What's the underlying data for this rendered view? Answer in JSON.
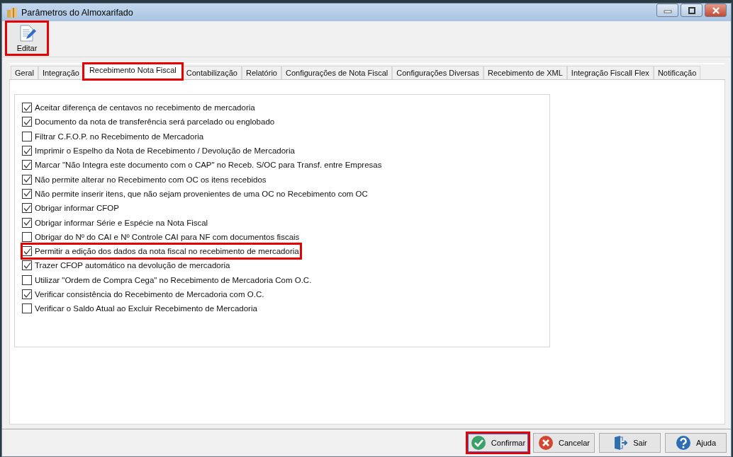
{
  "window": {
    "title": "Parâmetros do Almoxarifado"
  },
  "toolbar": [
    {
      "label": "Editar",
      "highlighted": true
    }
  ],
  "tabs": [
    {
      "label": "Geral",
      "selected": false,
      "highlighted": false
    },
    {
      "label": "Integração",
      "selected": false,
      "highlighted": false
    },
    {
      "label": "Recebimento Nota Fiscal",
      "selected": true,
      "highlighted": true
    },
    {
      "label": "Contabilização",
      "selected": false,
      "highlighted": false
    },
    {
      "label": "Relatório",
      "selected": false,
      "highlighted": false
    },
    {
      "label": "Configurações de Nota Fiscal",
      "selected": false,
      "highlighted": false
    },
    {
      "label": "Configurações Diversas",
      "selected": false,
      "highlighted": false
    },
    {
      "label": "Recebimento de XML",
      "selected": false,
      "highlighted": false
    },
    {
      "label": "Integração Fiscall Flex",
      "selected": false,
      "highlighted": false
    },
    {
      "label": "Notificação",
      "selected": false,
      "highlighted": false
    }
  ],
  "options": [
    {
      "label": "Aceitar diferença de centavos no recebimento de mercadoria",
      "checked": true,
      "highlighted": false
    },
    {
      "label": "Documento da nota de transferência será parcelado ou englobado",
      "checked": true,
      "highlighted": false
    },
    {
      "label": "Filtrar C.F.O.P. no Recebimento de Mercadoria",
      "checked": false,
      "highlighted": false
    },
    {
      "label": "Imprimir o Espelho da Nota de Recebimento / Devolução de Mercadoria",
      "checked": true,
      "highlighted": false
    },
    {
      "label": "Marcar \"Não Integra este documento com o CAP\" no Receb. S/OC para Transf. entre Empresas",
      "checked": true,
      "highlighted": false
    },
    {
      "label": "Não permite alterar no Recebimento com OC os itens recebidos",
      "checked": true,
      "highlighted": false
    },
    {
      "label": "Não permite inserir itens, que não sejam provenientes de uma OC no Recebimento com OC",
      "checked": true,
      "highlighted": false
    },
    {
      "label": "Obrigar informar CFOP",
      "checked": true,
      "highlighted": false
    },
    {
      "label": "Obrigar informar Série e Espécie na Nota Fiscal",
      "checked": true,
      "highlighted": false
    },
    {
      "label": "Obrigar do Nº do CAI e Nº Controle CAI para NF com documentos fiscais",
      "checked": false,
      "highlighted": false
    },
    {
      "label": "Permitir a edição dos dados da nota fiscal no recebimento de mercadoria",
      "checked": true,
      "highlighted": true
    },
    {
      "label": "Trazer CFOP automático na devolução de mercadoria",
      "checked": true,
      "highlighted": false
    },
    {
      "label": "Utilizar \"Ordem de Compra Cega\" no Recebimento de Mercadoria Com O.C.",
      "checked": false,
      "highlighted": false
    },
    {
      "label": "Verificar consistência do Recebimento de Mercadoria com O.C.",
      "checked": true,
      "highlighted": false
    },
    {
      "label": "Verificar o Saldo Atual ao Excluir Recebimento de Mercadoria",
      "checked": false,
      "highlighted": false
    }
  ],
  "buttons": [
    {
      "label": "Confirmar",
      "kind": "confirm",
      "highlighted": true,
      "focused": true
    },
    {
      "label": "Cancelar",
      "kind": "cancel",
      "highlighted": false,
      "focused": false
    },
    {
      "label": "Sair",
      "kind": "exit",
      "highlighted": false,
      "focused": false
    },
    {
      "label": "Ajuda",
      "kind": "help",
      "highlighted": false,
      "focused": false
    }
  ]
}
